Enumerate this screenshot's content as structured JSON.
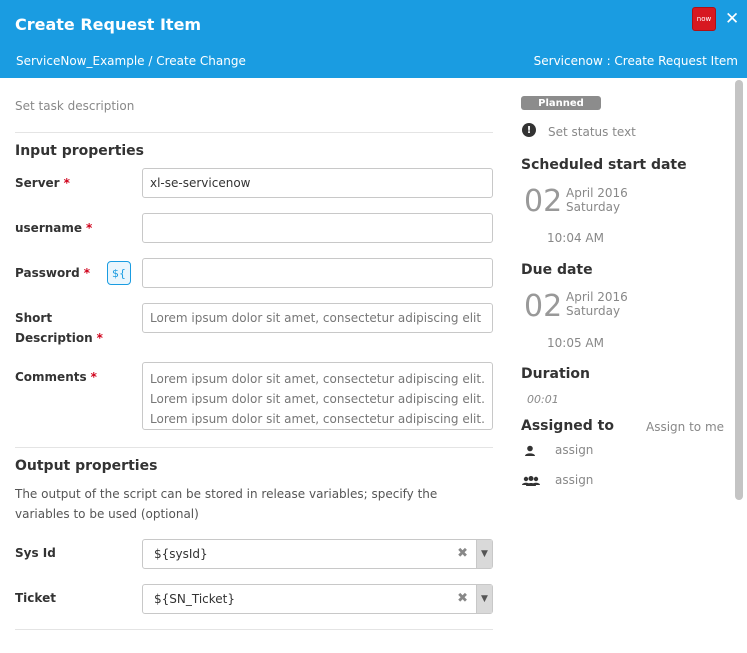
{
  "header": {
    "title": "Create Request Item",
    "breadcrumb": "ServiceNow_Example / Create Change",
    "task_type": "Servicenow : Create Request Item",
    "logo_text": "now",
    "close_glyph": "✕"
  },
  "task": {
    "description_placeholder": "Set task description"
  },
  "input_properties": {
    "title": "Input properties",
    "server": {
      "label": "Server",
      "value": "xl-se-servicenow"
    },
    "username": {
      "label": "username",
      "value": ""
    },
    "password": {
      "label": "Password",
      "value": "",
      "variable_button": "${"
    },
    "short_description": {
      "label": "Short Description",
      "value": "Lorem ipsum dolor sit amet, consectetur adipiscing elit"
    },
    "comments": {
      "label": "Comments",
      "value": "Lorem ipsum dolor sit amet, consectetur adipiscing elit.\nLorem ipsum dolor sit amet, consectetur adipiscing elit.\nLorem ipsum dolor sit amet, consectetur adipiscing elit."
    },
    "required_marker": "*"
  },
  "output_properties": {
    "title": "Output properties",
    "description": "The output of the script can be stored in release variables; specify the variables to be used (optional)",
    "sys_id": {
      "label": "Sys Id",
      "value": "${sysId}"
    },
    "ticket": {
      "label": "Ticket",
      "value": "${SN_Ticket}"
    },
    "clear_glyph": "✖",
    "caret_glyph": "▼"
  },
  "sidebar": {
    "status_badge": "Planned",
    "status_placeholder": "Set status text",
    "scheduled_start": {
      "title": "Scheduled start date",
      "day": "02",
      "month_year": "April 2016",
      "weekday": "Saturday",
      "time": "10:04 AM"
    },
    "due_date": {
      "title": "Due date",
      "day": "02",
      "month_year": "April 2016",
      "weekday": "Saturday",
      "time": "10:05 AM"
    },
    "duration": {
      "title": "Duration",
      "value": "00:01"
    },
    "assigned": {
      "title": "Assigned to",
      "assign_to_me": "Assign to me",
      "user_placeholder": "assign",
      "team_placeholder": "assign"
    }
  },
  "colors": {
    "header_bg": "#1a9ce1",
    "required": "#d0021b",
    "badge_bg": "#8c8c8c"
  }
}
